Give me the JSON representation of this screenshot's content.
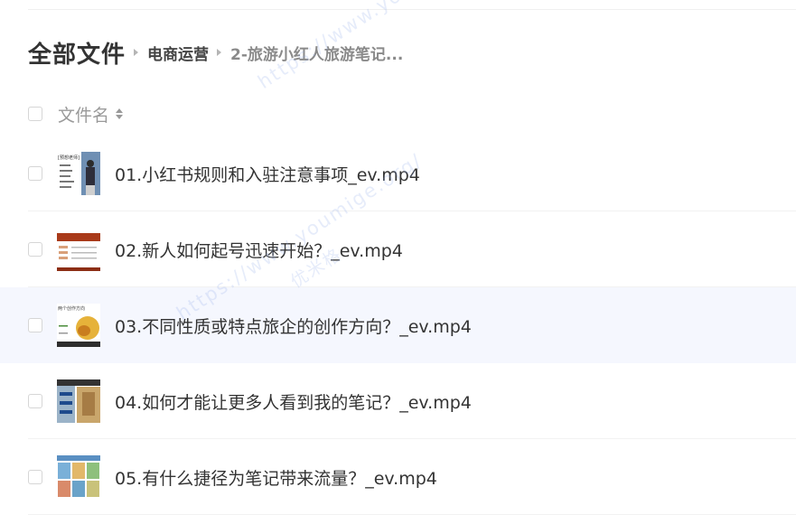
{
  "breadcrumb": {
    "root": "全部文件",
    "items": [
      "电商运营",
      "2-旅游小红人旅游笔记..."
    ]
  },
  "list_header": {
    "name_column": "文件名"
  },
  "files": [
    {
      "name": "01.小红书规则和入驻注意事项_ev.mp4",
      "thumb_text": "[预想老师]"
    },
    {
      "name": "02.新人如何起号迅速开始？_ev.mp4",
      "thumb_text": ""
    },
    {
      "name": "03.不同性质或特点旅企的创作方向？_ev.mp4",
      "thumb_text": "两个创作方向"
    },
    {
      "name": "04.如何才能让更多人看到我的笔记？_ev.mp4",
      "thumb_text": ""
    },
    {
      "name": "05.有什么捷径为笔记带来流量？_ev.mp4",
      "thumb_text": ""
    }
  ],
  "watermark": {
    "url": "https://www.youmige.org/",
    "text": "优米格"
  }
}
